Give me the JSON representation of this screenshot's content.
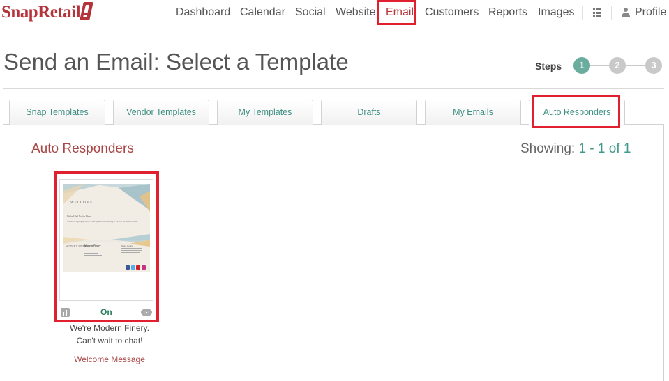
{
  "brand": {
    "logo_text": "SnapRetail"
  },
  "nav": {
    "items": [
      "Dashboard",
      "Calendar",
      "Social",
      "Website",
      "Email",
      "Customers",
      "Reports",
      "Images"
    ],
    "active": "Email",
    "profile_label": "Profile",
    "apps_icon": "grid-icon",
    "profile_icon": "person-icon"
  },
  "page": {
    "title": "Send an Email: Select a Template",
    "steps_label": "Steps",
    "steps": [
      "1",
      "2",
      "3"
    ],
    "current_step": "1"
  },
  "tabs": [
    "Snap Templates",
    "Vendor Templates",
    "My Templates",
    "Drafts",
    "My Emails",
    "Auto Responders"
  ],
  "active_tab": "Auto Responders",
  "section": {
    "title": "Auto Responders",
    "showing_label": "Showing:",
    "showing_range": "1 - 1 of 1"
  },
  "template_card": {
    "thumb": {
      "heading": "WELCOME",
      "subheading": "We're Glad You're Here",
      "body": "Thanks for signing up for our email updates! Now relaxing in the loop will be even easier.",
      "brand_wordmark": "MODERN FINERY",
      "store_name": "Modern Finery",
      "hours_title": "Store Hours"
    },
    "status": "On",
    "stats_icon": "bar-chart-icon",
    "preview_icon": "eye-icon",
    "caption_line1": "We're Modern Finery.",
    "caption_line2": "Can't wait to chat!",
    "link_label": "Welcome Message"
  },
  "colors": {
    "brand_red": "#b5343c",
    "teal": "#3f8f83",
    "step_active": "#6aac9d",
    "highlight_red": "#e0202e",
    "section_red": "#a94646",
    "status_green": "#2f7f5f"
  }
}
